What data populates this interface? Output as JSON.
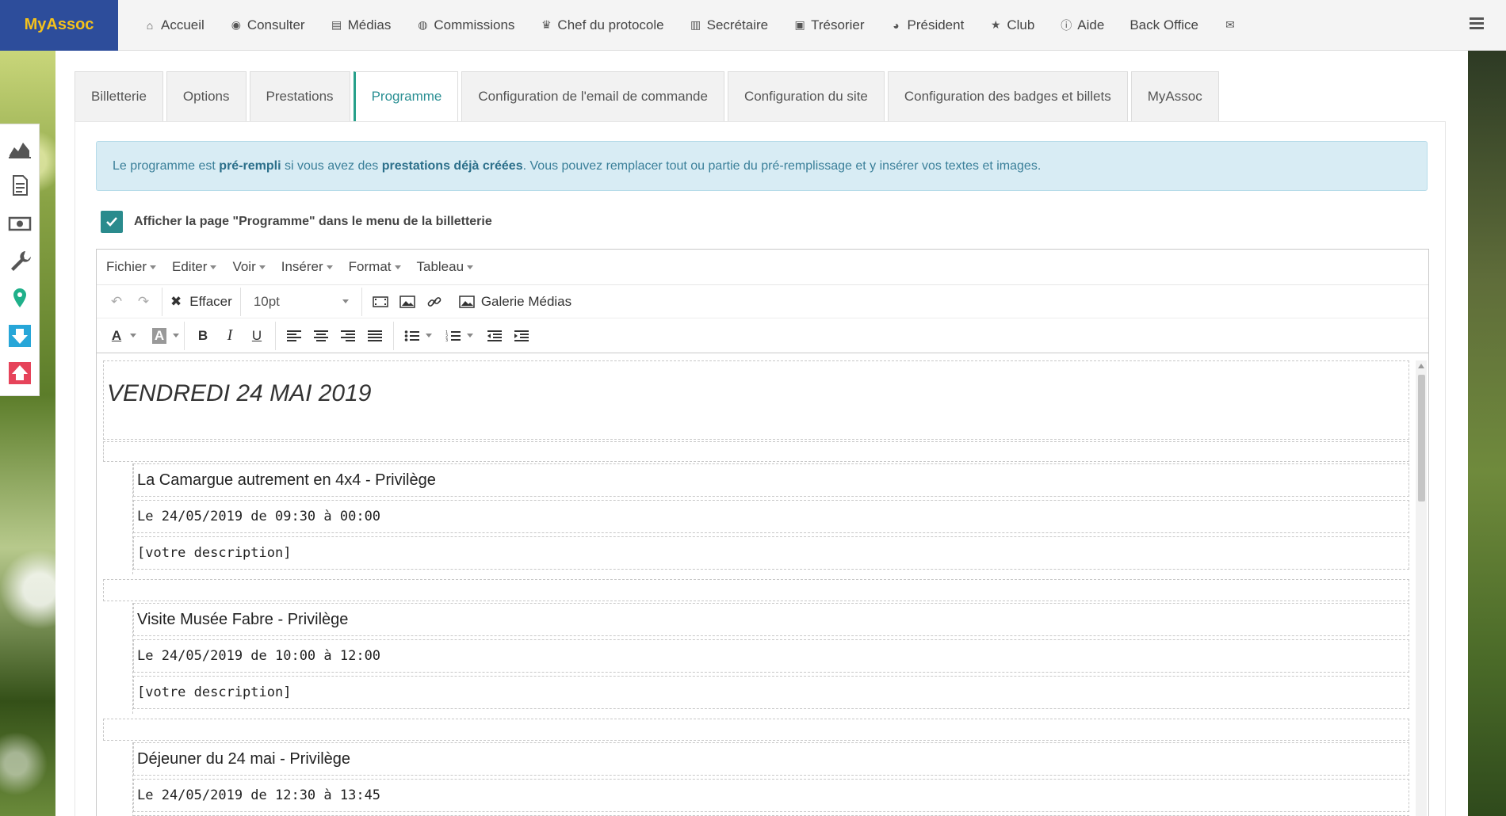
{
  "brand": "MyAssoc",
  "nav": [
    {
      "icon": "home-icon",
      "glyph": "⌂",
      "label": "Accueil"
    },
    {
      "icon": "eye-icon",
      "glyph": "◉",
      "label": "Consulter"
    },
    {
      "icon": "file-icon",
      "glyph": "▤",
      "label": "Médias"
    },
    {
      "icon": "users-icon",
      "glyph": "◍",
      "label": "Commissions"
    },
    {
      "icon": "trophy-icon",
      "glyph": "♛",
      "label": "Chef du protocole"
    },
    {
      "icon": "book-icon",
      "glyph": "▥",
      "label": "Secrétaire"
    },
    {
      "icon": "money-icon",
      "glyph": "▣",
      "label": "Trésorier"
    },
    {
      "icon": "globe-icon",
      "glyph": "◕",
      "label": "Président"
    },
    {
      "icon": "star-icon",
      "glyph": "★",
      "label": "Club"
    },
    {
      "icon": "info-icon",
      "glyph": "ⓘ",
      "label": "Aide"
    },
    {
      "icon": "",
      "glyph": "",
      "label": "Back Office"
    },
    {
      "icon": "envelope-icon",
      "glyph": "✉",
      "label": ""
    }
  ],
  "tabs": [
    {
      "label": "Billetterie",
      "active": false
    },
    {
      "label": "Options",
      "active": false
    },
    {
      "label": "Prestations",
      "active": false
    },
    {
      "label": "Programme",
      "active": true
    },
    {
      "label": "Configuration de l'email de commande",
      "active": false
    },
    {
      "label": "Configuration du site",
      "active": false
    },
    {
      "label": "Configuration des badges et billets",
      "active": false
    },
    {
      "label": "MyAssoc",
      "active": false
    }
  ],
  "alert": {
    "p1": "Le programme est ",
    "b1": "pré-rempli",
    "p2": " si vous avez des ",
    "b2": "prestations déjà créées",
    "p3": ". Vous pouvez remplacer tout ou partie du pré-remplissage et y insérer vos textes et images."
  },
  "show_page": {
    "checked": true,
    "label": "Afficher la page \"Programme\" dans le menu de la billetterie"
  },
  "editor": {
    "menus": [
      "Fichier",
      "Editer",
      "Voir",
      "Insérer",
      "Format",
      "Tableau"
    ],
    "clear_label": "Effacer",
    "font_size": "10pt",
    "gallery_label": "Galerie Médias",
    "date_heading": "VENDREDI 24 MAI 2019",
    "events": [
      {
        "title": "La Camargue autrement en 4x4 - Privilège",
        "when": "Le 24/05/2019 de 09:30 à 00:00",
        "desc": "[votre description]"
      },
      {
        "title": "Visite Musée Fabre - Privilège",
        "when": "Le 24/05/2019 de 10:00 à 12:00",
        "desc": "[votre description]"
      },
      {
        "title": "Déjeuner du 24 mai - Privilège",
        "when": "Le 24/05/2019 de 12:30 à 13:45",
        "desc": ""
      }
    ]
  },
  "colors": {
    "brand_bg": "#2d4d9b",
    "brand_text": "#f5c21b",
    "accent": "#27a08a",
    "alert_bg": "#d8ecf4"
  }
}
